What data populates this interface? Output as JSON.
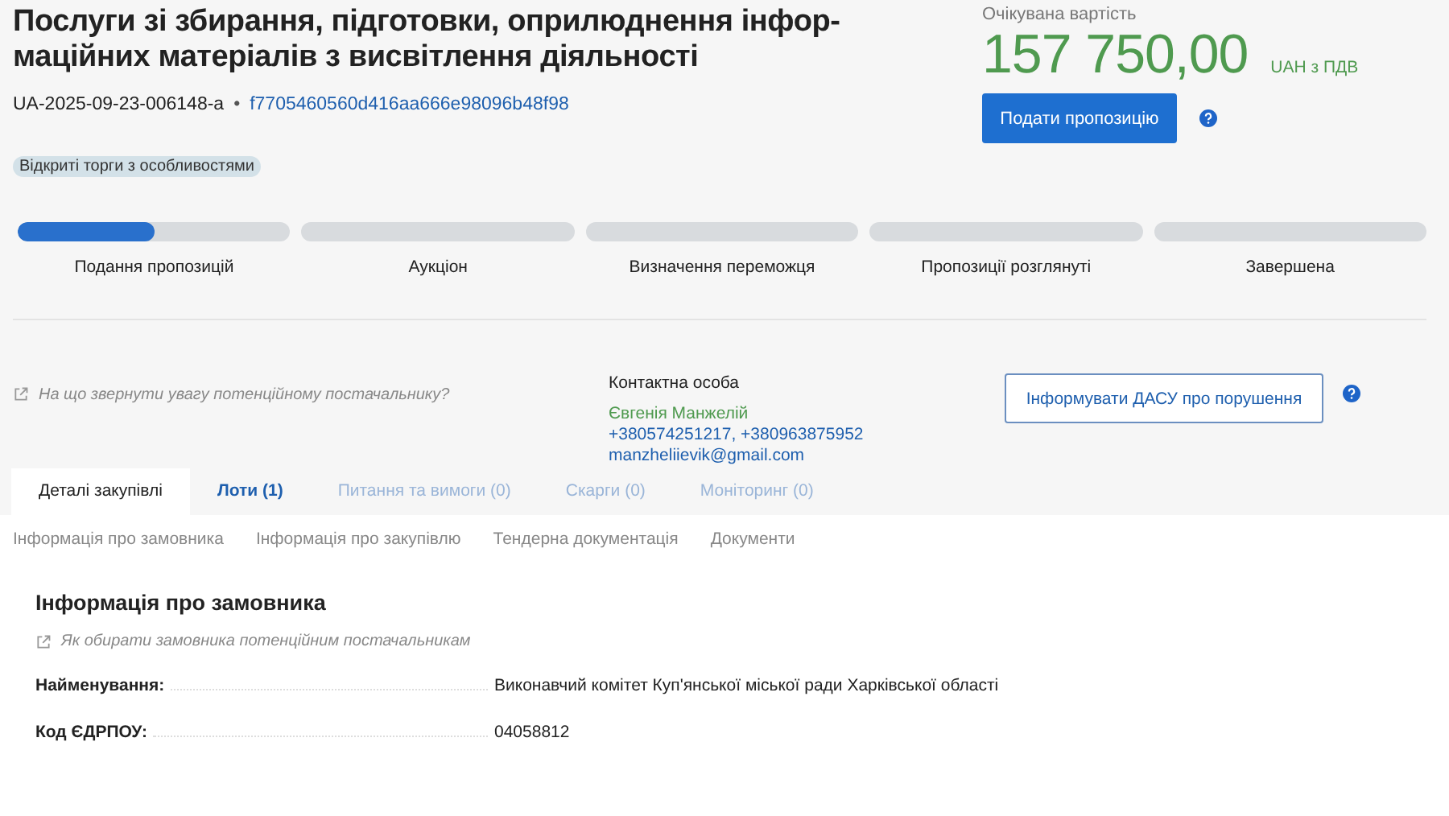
{
  "title_lines": [
    "Послуги зі збирання, підготовки, оприлюднення інфор-",
    "маційних матеріалів з висвітлення діяльності"
  ],
  "tender_id": "UA-2025-09-23-006148-a",
  "separator": "•",
  "hash_link": "f7705460560d416aa666e98096b48f98",
  "procedure_badge": "Відкриті торги з особливостями",
  "expected_value": {
    "label": "Очікувана вартість",
    "amount": "157 750,00",
    "currency": "UAH з ПДВ"
  },
  "submit_button": "Подати пропозицію",
  "stages": [
    {
      "label": "Подання пропозицій",
      "level": 0.5
    },
    {
      "label": "Аукціон",
      "level": 0
    },
    {
      "label": "Визначення переможця",
      "level": 0
    },
    {
      "label": "Пропозиції розглянуті",
      "level": 0
    },
    {
      "label": "Завершена",
      "level": 0
    }
  ],
  "supplier_hint": "На що звернути увагу потенційному постачальнику?",
  "contact": {
    "heading": "Контактна особа",
    "name": "Євгенія Манжелій",
    "phones": "+380574251217, +380963875952",
    "email": "manzheliievik@gmail.com"
  },
  "report_button": "Інформувати ДАСУ про порушення",
  "tabs": [
    {
      "label": "Деталі закупівлі",
      "selected": true,
      "disabled": false
    },
    {
      "label": "Лоти (1)",
      "selected": false,
      "disabled": false
    },
    {
      "label": "Питання та вимоги (0)",
      "selected": false,
      "disabled": true
    },
    {
      "label": "Скарги (0)",
      "selected": false,
      "disabled": true
    },
    {
      "label": "Моніторинг (0)",
      "selected": false,
      "disabled": true
    }
  ],
  "subnav": [
    "Інформація про замовника",
    "Інформація про закупівлю",
    "Тендерна документація",
    "Документи"
  ],
  "section": {
    "title": "Інформація про замовника",
    "hint": "Як обирати замовника потенційним постачальникам",
    "rows": [
      {
        "label": "Найменування:",
        "value": "Виконавчий комітет Куп'янської міської ради Харківської області"
      },
      {
        "label": "Код ЄДРПОУ:",
        "value": "04058812"
      }
    ]
  }
}
